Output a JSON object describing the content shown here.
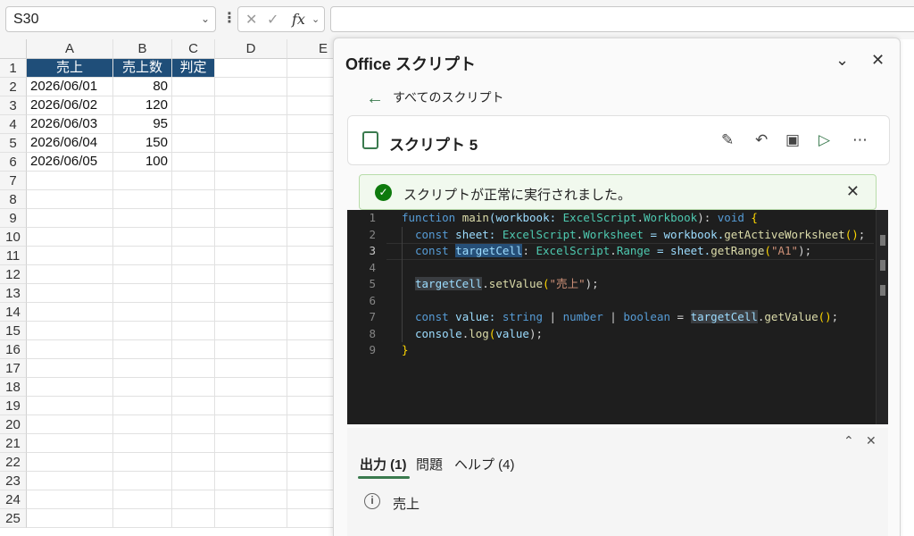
{
  "formula_bar": {
    "name_box": "S30",
    "cancel_icon": "✕",
    "enter_icon": "✓",
    "fx_label": "fx",
    "formula": ""
  },
  "sheet": {
    "columns": [
      "A",
      "B",
      "C",
      "D",
      "E"
    ],
    "rows": [
      "1",
      "2",
      "3",
      "4",
      "5",
      "6",
      "7",
      "8",
      "9",
      "10",
      "11",
      "12",
      "13",
      "14",
      "15",
      "16",
      "17",
      "18",
      "19",
      "20",
      "21",
      "22",
      "23",
      "24",
      "25"
    ],
    "header": [
      "売上",
      "売上数",
      "判定"
    ],
    "data": [
      [
        "2026/06/01",
        "80"
      ],
      [
        "2026/06/02",
        "120"
      ],
      [
        "2026/06/03",
        "95"
      ],
      [
        "2026/06/04",
        "150"
      ],
      [
        "2026/06/05",
        "100"
      ]
    ],
    "header_color": "#1f4e79"
  },
  "pane": {
    "title": "Office スクリプト",
    "back_label": "すべてのスクリプト",
    "script_name": "スクリプト 5",
    "success_message": "スクリプトが正常に実行されました。",
    "tabs": [
      {
        "label": "出力 (1)"
      },
      {
        "label": "問題"
      },
      {
        "label": "ヘルプ (4)"
      }
    ],
    "log": "売上",
    "accent_color": "#3a7a4e",
    "success_color": "#0e7a0d"
  },
  "editor": {
    "line_numbers": [
      "1",
      "2",
      "3",
      "4",
      "5",
      "6",
      "7",
      "8",
      "9"
    ],
    "active_line": "3",
    "tokens": {
      "l1": [
        "function",
        " main",
        "(workbook: ",
        "ExcelScript",
        ".",
        "Workbook",
        "): ",
        "void",
        " ",
        "{"
      ],
      "l2": [
        "const",
        " sheet: ",
        "ExcelScript",
        ".",
        "Worksheet",
        " = workbook.",
        "getActiveWorksheet",
        "()",
        ";"
      ],
      "l3": [
        "const",
        " ",
        "targetCell",
        ": ",
        "ExcelScript",
        ".",
        "Range",
        " = sheet.",
        "getRange",
        "(",
        "\"A1\"",
        ");"
      ],
      "l5": [
        "targetCell",
        ".",
        "setValue",
        "(",
        "\"売上\"",
        ");"
      ],
      "l7": [
        "const",
        " value: ",
        "string",
        " | ",
        "number",
        " | ",
        "boolean",
        " = ",
        "targetCell",
        ".",
        "getValue",
        "()",
        ";"
      ],
      "l8": [
        "console",
        ".",
        "log",
        "(",
        "value",
        ");"
      ],
      "l9": [
        "}"
      ]
    }
  }
}
